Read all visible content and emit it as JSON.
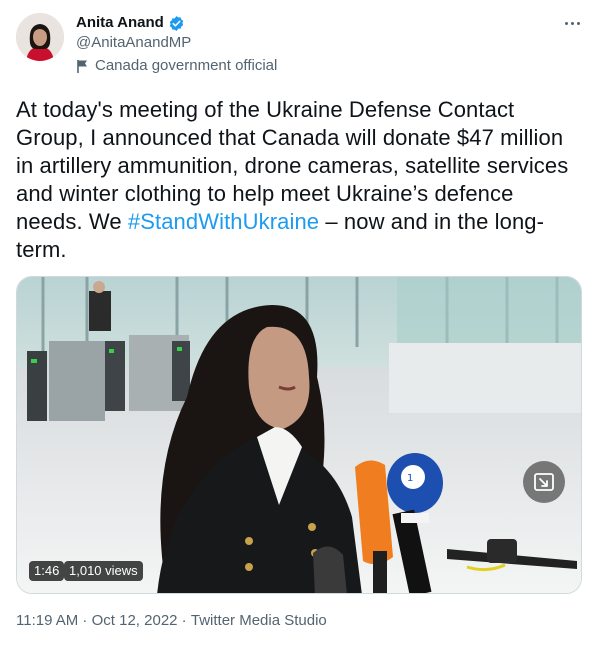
{
  "author": {
    "name": "Anita Anand",
    "handle": "@AnitaAnandMP",
    "label": "Canada government official"
  },
  "tweet": {
    "text_before": "At today's meeting of the Ukraine Defense Contact Group, I announced that Canada will donate $47 million in artillery ammunition, drone cameras, satellite services and winter clothing to help meet Ukraine’s defence needs. We ",
    "hashtag": "#StandWithUkraine",
    "text_after": " – now and in the long-term."
  },
  "media": {
    "duration": "1:46",
    "views": "1,010 views"
  },
  "meta": {
    "time": "11:19 AM",
    "separator1": " · ",
    "date": "Oct 12, 2022",
    "separator2": " · ",
    "source": "Twitter Media Studio"
  },
  "colors": {
    "accent": "#1d9bf0",
    "text": "#0f1419",
    "muted": "#536471"
  },
  "icons": {
    "verified": "verified-badge-icon",
    "label": "flag-icon",
    "more": "more-options-icon",
    "expand": "expand-video-icon"
  }
}
